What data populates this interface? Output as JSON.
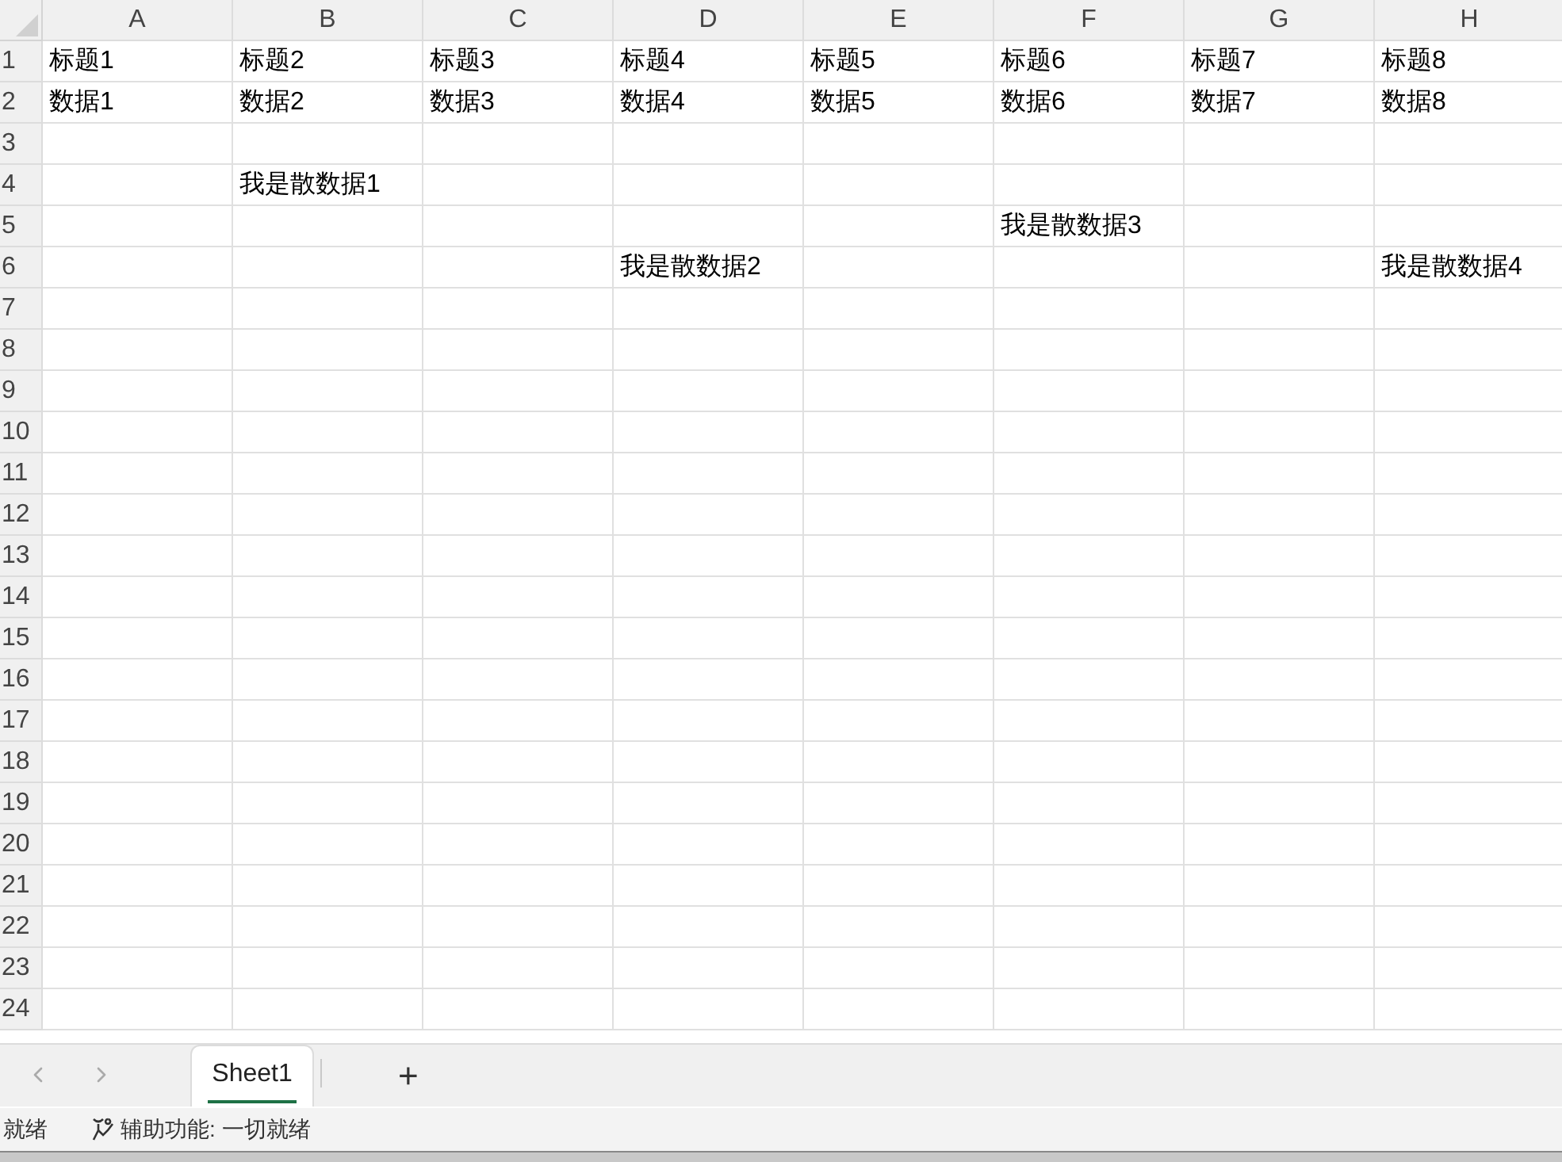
{
  "columns": [
    "A",
    "B",
    "C",
    "D",
    "E",
    "F",
    "G",
    "H"
  ],
  "rows": [
    {
      "label": "1",
      "cells": [
        "标题1",
        "标题2",
        "标题3",
        "标题4",
        "标题5",
        "标题6",
        "标题7",
        "标题8"
      ]
    },
    {
      "label": "2",
      "cells": [
        "数据1",
        "数据2",
        "数据3",
        "数据4",
        "数据5",
        "数据6",
        "数据7",
        "数据8"
      ]
    },
    {
      "label": "3",
      "cells": [
        null,
        null,
        null,
        null,
        null,
        null,
        null,
        null
      ]
    },
    {
      "label": "4",
      "cells": [
        null,
        "我是散数据1",
        null,
        null,
        null,
        null,
        null,
        null
      ]
    },
    {
      "label": "5",
      "cells": [
        null,
        null,
        null,
        null,
        null,
        "我是散数据3",
        null,
        null
      ]
    },
    {
      "label": "6",
      "cells": [
        null,
        null,
        null,
        "我是散数据2",
        null,
        null,
        null,
        "我是散数据4"
      ]
    },
    {
      "label": "7"
    },
    {
      "label": "8"
    },
    {
      "label": "9"
    },
    {
      "label": "10"
    },
    {
      "label": "11"
    },
    {
      "label": "12"
    },
    {
      "label": "13"
    },
    {
      "label": "14"
    },
    {
      "label": "15"
    },
    {
      "label": "16"
    },
    {
      "label": "17"
    },
    {
      "label": "18"
    },
    {
      "label": "19"
    },
    {
      "label": "20"
    },
    {
      "label": "21"
    },
    {
      "label": "22"
    },
    {
      "label": "23"
    },
    {
      "label": "24"
    }
  ],
  "sheet_tabs": [
    {
      "label": "Sheet1",
      "selected": true
    }
  ],
  "add_sheet": "+",
  "status_bar": {
    "status": "就绪",
    "accessibility": "辅助功能: 一切就绪"
  }
}
